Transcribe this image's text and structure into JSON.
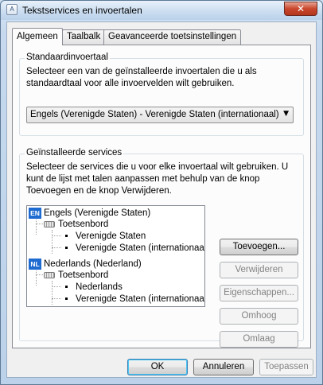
{
  "window": {
    "title": "Tekstservices en invoertalen",
    "close_glyph": "✕"
  },
  "tabs": [
    {
      "label": "Algemeen",
      "active": true
    },
    {
      "label": "Taalbalk",
      "active": false
    },
    {
      "label": "Geavanceerde toetsinstellingen",
      "active": false
    }
  ],
  "default_input": {
    "legend": "Standaardinvoertaal",
    "description": "Selecteer een van de geïnstalleerde invoertalen die u als standaardtaal voor alle invoervelden wilt gebruiken.",
    "selected": "Engels (Verenigde Staten) - Verenigde Staten (internationaal)"
  },
  "installed_services": {
    "legend": "Geïnstalleerde services",
    "description": "Selecteer de services die u voor elke invoertaal wilt gebruiken. U kunt de lijst met talen aanpassen met behulp van de knop Toevoegen en de knop Verwijderen.",
    "tree": [
      {
        "badge": "EN",
        "language": "Engels (Verenigde Staten)",
        "group": "Toetsenbord",
        "items": [
          "Verenigde Staten",
          "Verenigde Staten (internationaal)"
        ]
      },
      {
        "badge": "NL",
        "language": "Nederlands (Nederland)",
        "group": "Toetsenbord",
        "items": [
          "Nederlands",
          "Verenigde Staten (internationaal)"
        ]
      }
    ],
    "buttons": {
      "add": "Toevoegen...",
      "remove": "Verwijderen",
      "properties": "Eigenschappen...",
      "move_up": "Omhoog",
      "move_down": "Omlaag"
    }
  },
  "footer": {
    "ok": "OK",
    "cancel": "Annuleren",
    "apply": "Toepassen"
  },
  "colors": {
    "badge": "#1d6bd1",
    "close_button": "#c9462c"
  }
}
